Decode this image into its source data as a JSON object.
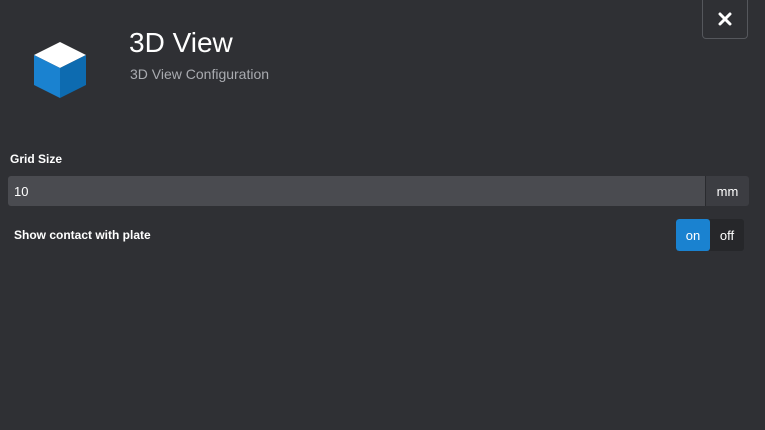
{
  "header": {
    "title": "3D View",
    "subtitle": "3D View Configuration",
    "icon": "cube-icon",
    "close_icon": "close-icon"
  },
  "grid_size": {
    "label": "Grid Size",
    "value": "10",
    "unit": "mm"
  },
  "contact_with_plate": {
    "label": "Show contact with plate",
    "options": [
      "on",
      "off"
    ],
    "selected": "on"
  },
  "colors": {
    "background": "#2f3034",
    "accent": "#1a82d0",
    "input_bg": "#4a4b50"
  }
}
